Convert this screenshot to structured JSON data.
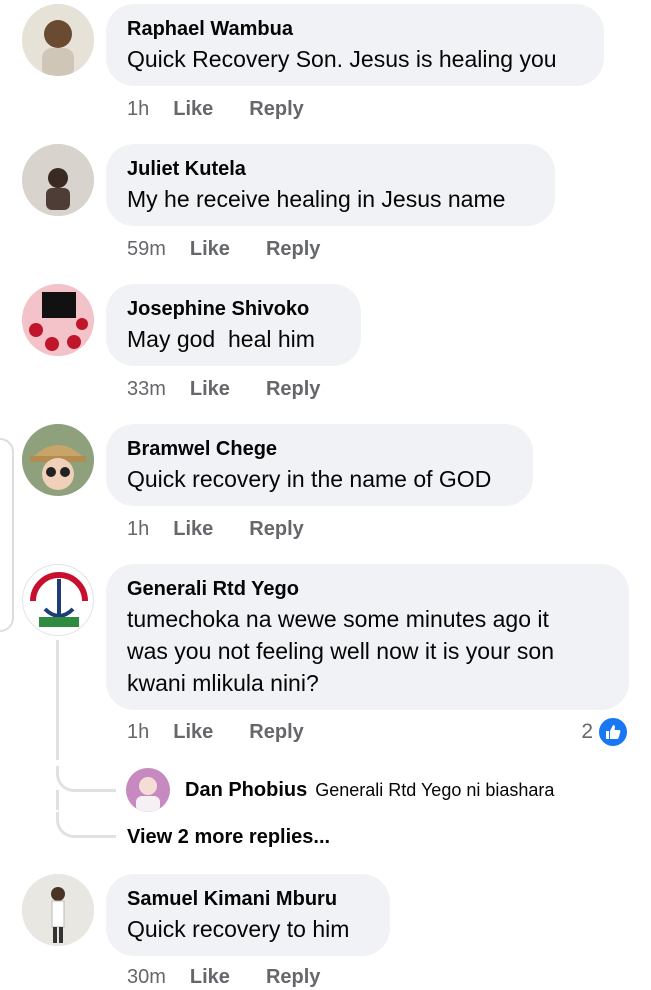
{
  "comments": [
    {
      "author": "Raphael Wambua",
      "text": "Quick Recovery Son. Jesus is healing you",
      "time": "1h",
      "like": "Like",
      "reply": "Reply"
    },
    {
      "author": "Juliet Kutela",
      "text": "My he receive healing in Jesus name",
      "time": "59m",
      "like": "Like",
      "reply": "Reply"
    },
    {
      "author": "Josephine Shivoko",
      "text": "May god  heal him",
      "time": "33m",
      "like": "Like",
      "reply": "Reply"
    },
    {
      "author": "Bramwel Chege",
      "text": "Quick recovery in the name of GOD",
      "time": "1h",
      "like": "Like",
      "reply": "Reply"
    },
    {
      "author": "Generali Rtd Yego",
      "text_lines": [
        "tumechoka na wewe some minutes ago it",
        "was you not feeling well now it is your son",
        "kwani mlikula nini?"
      ],
      "time": "1h",
      "like": "Like",
      "reply": "Reply",
      "reaction_count": "2"
    },
    {
      "author": "Samuel Kimani Mburu",
      "text": "Quick recovery to him",
      "time": "30m",
      "like": "Like",
      "reply": "Reply"
    }
  ],
  "reply_preview": {
    "author": "Dan Phobius",
    "text": "Generali Rtd Yego ni biashara"
  },
  "view_more": "View 2 more replies...",
  "colors": {
    "bubble": "#f0f2f5",
    "meta": "#65676b",
    "like_blue": "#1877f2"
  },
  "icons": [
    "like-reaction-icon"
  ]
}
